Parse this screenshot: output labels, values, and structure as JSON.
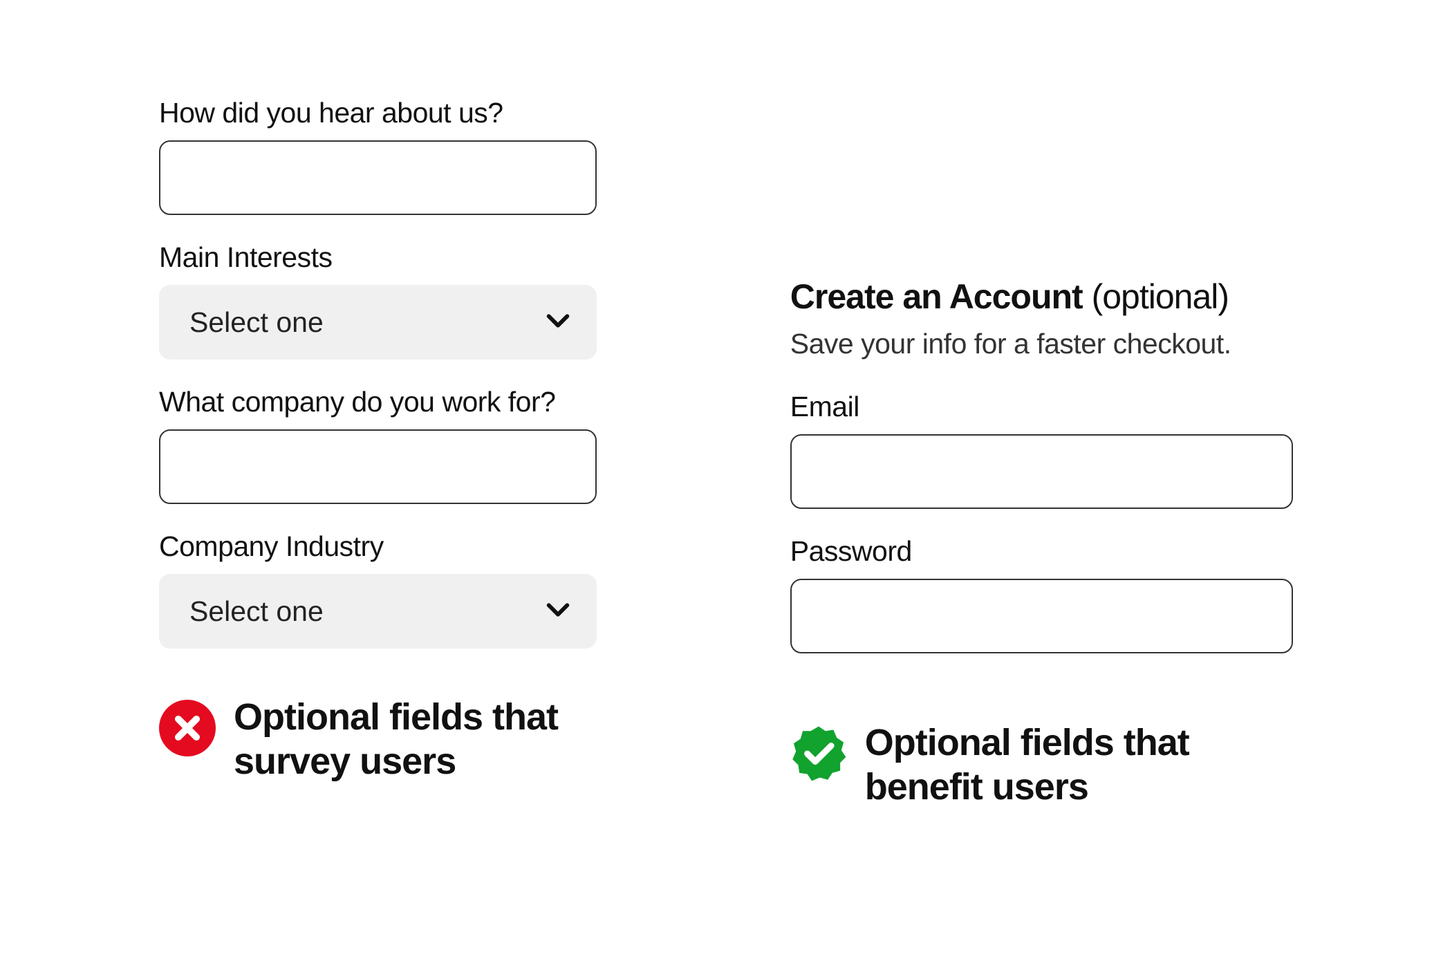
{
  "left": {
    "fields": {
      "hear_about_label": "How did you hear about us?",
      "interests_label": "Main Interests",
      "interests_selected": "Select one",
      "company_label": "What company do you work for?",
      "industry_label": "Company Industry",
      "industry_selected": "Select one"
    },
    "callout": "Optional fields that survey users"
  },
  "right": {
    "heading_bold": "Create an Account",
    "heading_light": " (optional)",
    "subheading": "Save your info for a faster checkout.",
    "email_label": "Email",
    "password_label": "Password",
    "callout": "Optional fields that benefit users"
  },
  "colors": {
    "error_red": "#e40b20",
    "success_green": "#12a22e"
  }
}
